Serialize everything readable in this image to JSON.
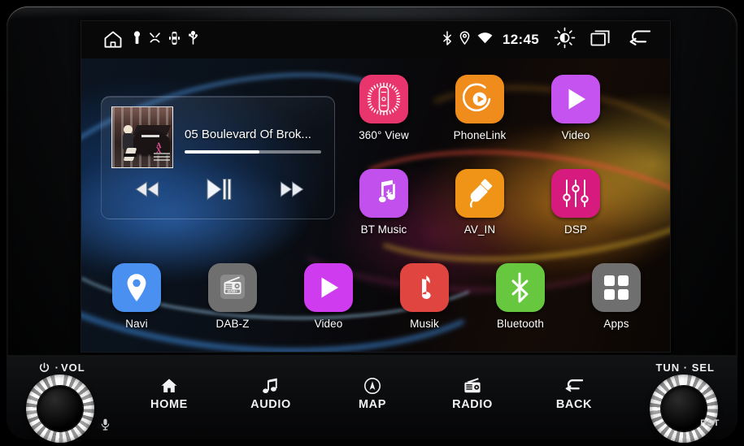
{
  "device": {
    "left_knob": {
      "label": "VOL",
      "power_icon": "power-icon",
      "mic_icon": "microphone-icon"
    },
    "right_knob": {
      "label": "TUN · SEL"
    },
    "reset_label": "RST"
  },
  "statusbar": {
    "home_icon": "home-icon",
    "left_icons": [
      "key-icon",
      "seatbelt-icon",
      "parking-sensor-icon",
      "usb-icon"
    ],
    "right_icons": [
      "bluetooth-icon",
      "location-icon",
      "wifi-icon"
    ],
    "clock": "12:45",
    "brightness_icon": "brightness-icon",
    "recents_icon": "recent-apps-icon",
    "back_icon": "back-arrow-icon"
  },
  "media_widget": {
    "track_title": "05 Boulevard Of Brok...",
    "progress_percent": 55,
    "album_art_alt": "album-art",
    "prev_icon": "rewind-icon",
    "play_icon": "play-pause-icon",
    "next_icon": "fast-forward-icon"
  },
  "apps": [
    {
      "label": "360° View",
      "icon": "car-360-view-icon",
      "color": "#e8356d"
    },
    {
      "label": "PhoneLink",
      "icon": "phonelink-play-icon",
      "color": "#ef8c1b"
    },
    {
      "label": "Video",
      "icon": "video-play-icon",
      "color": "#c453f0"
    },
    {
      "label": "BT Music",
      "icon": "bt-music-icon",
      "color": "#c150ec"
    },
    {
      "label": "AV_IN",
      "icon": "rca-plug-icon",
      "color": "#ef9417"
    },
    {
      "label": "DSP",
      "icon": "equalizer-sliders-icon",
      "color": "#d61a7e"
    },
    {
      "label": "Navi",
      "icon": "map-pin-icon",
      "color": "#4a90f0"
    },
    {
      "label": "DAB-Z",
      "icon": "dab-radio-icon",
      "color": "#6f6f6f"
    },
    {
      "label": "Video",
      "icon": "video-play-icon",
      "color": "#cf3cf0"
    },
    {
      "label": "Musik",
      "icon": "music-note-icon",
      "color": "#e0453f"
    },
    {
      "label": "Bluetooth",
      "icon": "bluetooth-icon",
      "color": "#67c83f"
    },
    {
      "label": "Apps",
      "icon": "apps-grid-icon",
      "color": "#6f6f6f"
    }
  ],
  "hardware_buttons": [
    {
      "label": "HOME",
      "icon": "home-icon"
    },
    {
      "label": "AUDIO",
      "icon": "music-notes-icon"
    },
    {
      "label": "MAP",
      "icon": "map-navigate-icon"
    },
    {
      "label": "RADIO",
      "icon": "radio-icon"
    },
    {
      "label": "BACK",
      "icon": "back-arrow-icon"
    }
  ],
  "dab_badge": "DAB+"
}
